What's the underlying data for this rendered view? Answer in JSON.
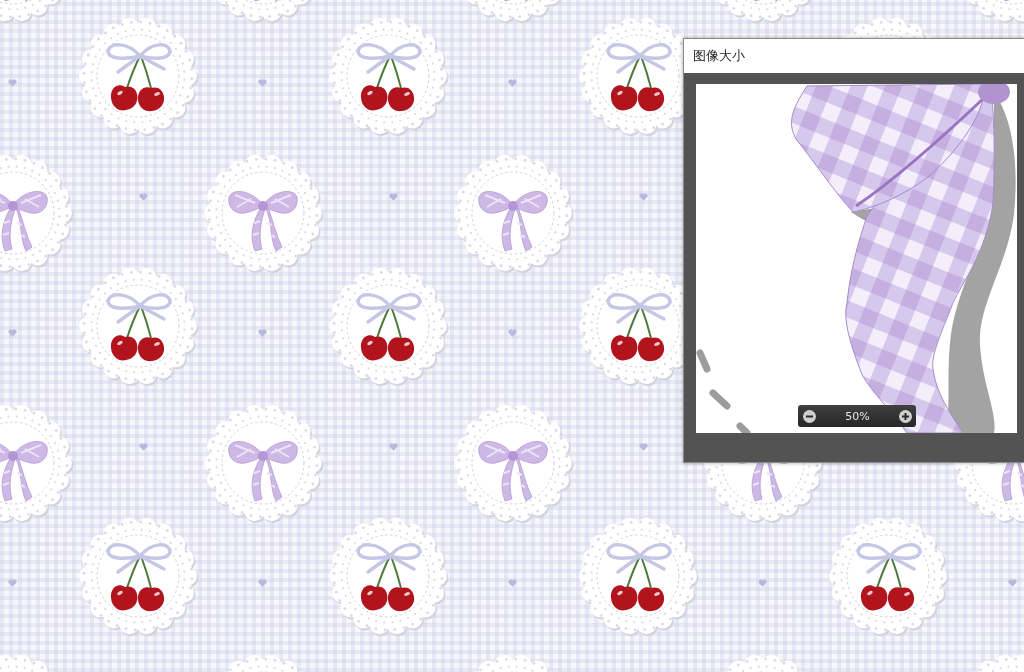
{
  "dialog": {
    "title": "图像大小",
    "zoom_control": {
      "value": "50%"
    }
  }
}
